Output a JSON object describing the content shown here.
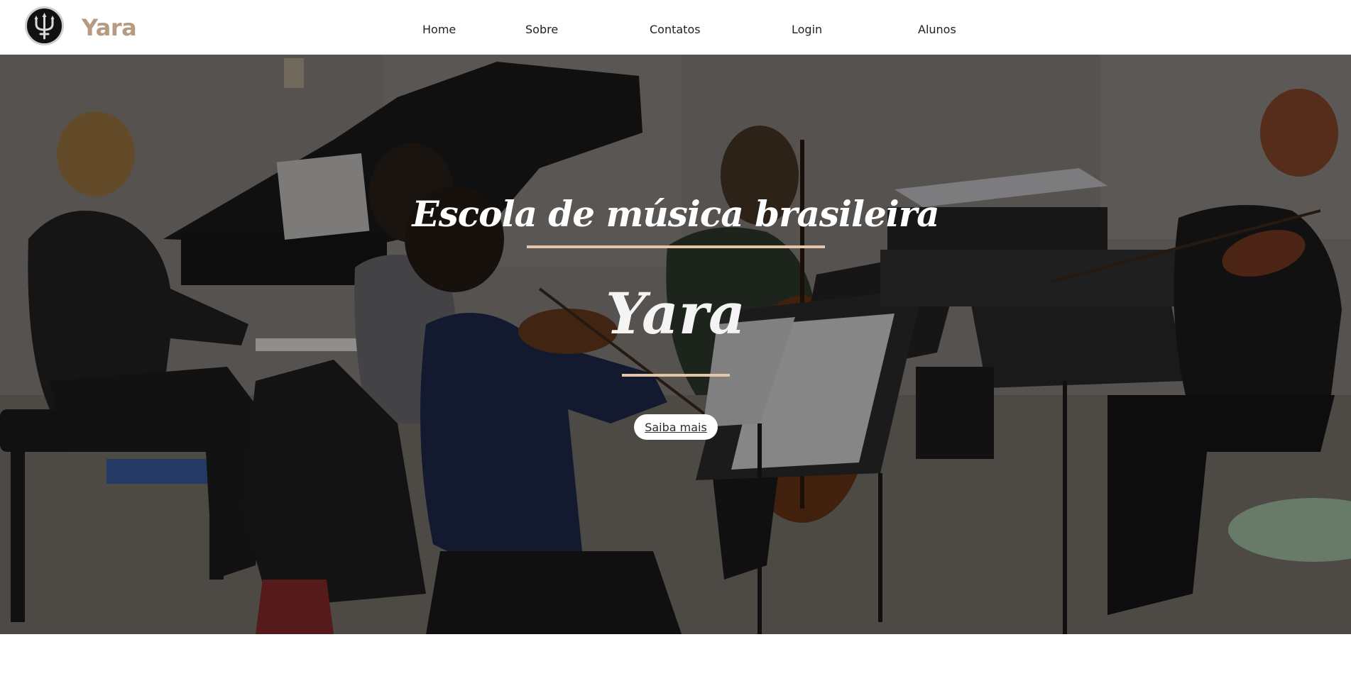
{
  "header": {
    "brand": "Yara",
    "logo_icon": "trident-icon",
    "nav": [
      {
        "label": "Home"
      },
      {
        "label": "Sobre"
      },
      {
        "label": "Contatos"
      },
      {
        "label": "Login"
      },
      {
        "label": "Alunos"
      }
    ]
  },
  "hero": {
    "title": "Escola de música brasileira",
    "name": "Yara",
    "cta_label": "Saiba mais",
    "accent_color": "#e3c6a5",
    "brand_color": "#b69b83"
  }
}
